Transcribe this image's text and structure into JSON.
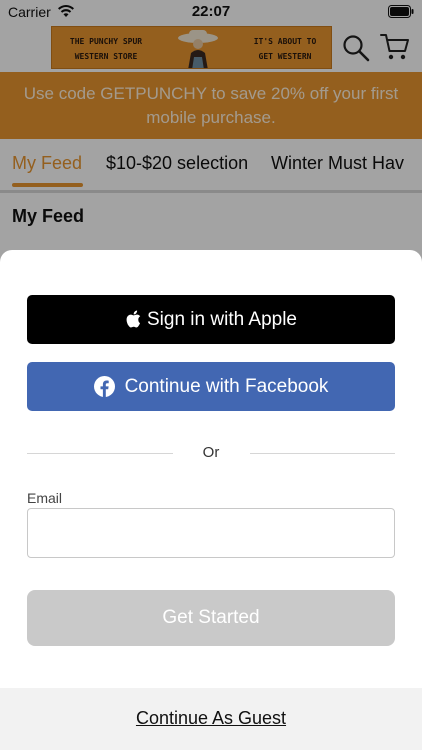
{
  "status_bar": {
    "carrier": "Carrier",
    "time": "22:07"
  },
  "header": {
    "banner_left": "THE PUNCHY SPUR WESTERN STORE",
    "banner_right": "IT'S ABOUT TO GET WESTERN",
    "search_icon": "search-icon",
    "cart_icon": "cart-icon"
  },
  "promo": {
    "text": "Use code GETPUNCHY to save 20% off your first mobile purchase."
  },
  "tabs": [
    {
      "label": "My Feed",
      "active": true
    },
    {
      "label": "$10-$20 selection",
      "active": false
    },
    {
      "label": "Winter Must Hav",
      "active": false
    }
  ],
  "feed": {
    "title": "My Feed"
  },
  "sheet": {
    "apple_label": "Sign in with Apple",
    "facebook_label": "Continue with Facebook",
    "or_label": "Or",
    "email_label": "Email",
    "email_value": "",
    "email_placeholder": "",
    "get_started_label": "Get Started",
    "guest_label": "Continue As Guest"
  },
  "colors": {
    "accent": "#e8952f",
    "facebook": "#4267b2",
    "apple": "#000000",
    "disabled": "#c9c9c9"
  }
}
